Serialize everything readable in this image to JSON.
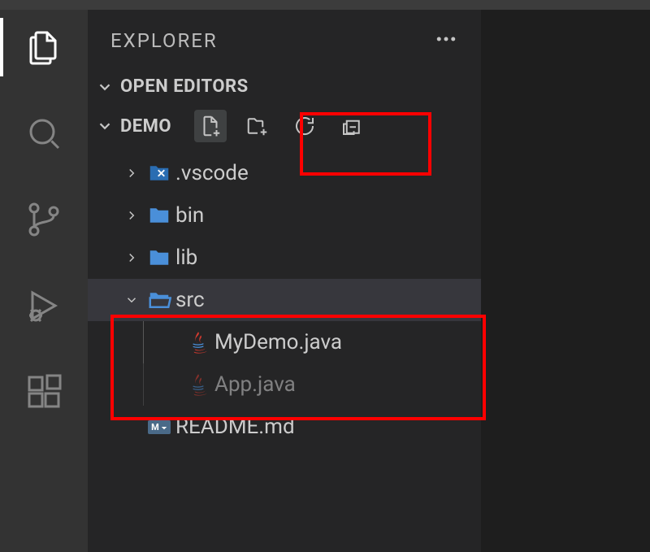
{
  "sidebar": {
    "title": "EXPLORER",
    "sections": {
      "open_editors": {
        "label": "OPEN EDITORS",
        "expanded": true
      },
      "workspace": {
        "label": "DEMO",
        "expanded": true,
        "toolbar": {
          "new_file": "New File",
          "new_folder": "New Folder",
          "refresh": "Refresh",
          "collapse": "Collapse All"
        }
      }
    }
  },
  "tree": {
    "items": [
      {
        "kind": "folder",
        "name": ".vscode",
        "expanded": false,
        "icon": "vscode-folder"
      },
      {
        "kind": "folder",
        "name": "bin",
        "expanded": false,
        "icon": "folder"
      },
      {
        "kind": "folder",
        "name": "lib",
        "expanded": false,
        "icon": "folder"
      },
      {
        "kind": "folder",
        "name": "src",
        "expanded": true,
        "icon": "folder-open",
        "selected": true,
        "children": [
          {
            "kind": "file",
            "name": "MyDemo.java",
            "icon": "java"
          },
          {
            "kind": "file",
            "name": "App.java",
            "icon": "java",
            "dimmed": true
          }
        ]
      },
      {
        "kind": "file",
        "name": "README.md",
        "icon": "markdown"
      }
    ]
  },
  "activity": {
    "items": [
      {
        "id": "explorer",
        "active": true
      },
      {
        "id": "search",
        "active": false
      },
      {
        "id": "scm",
        "active": false
      },
      {
        "id": "debug",
        "active": false
      },
      {
        "id": "extensions",
        "active": false
      }
    ]
  },
  "callouts": [
    {
      "id": 1,
      "target": "new-file / new-folder toolbar buttons"
    },
    {
      "id": 2,
      "target": "src folder and MyDemo.java"
    }
  ]
}
